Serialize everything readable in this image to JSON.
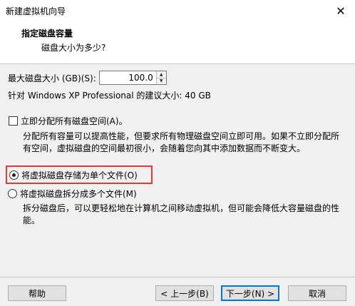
{
  "window": {
    "title": "新建虚拟机向导",
    "close_symbol": "✕"
  },
  "header": {
    "title": "指定磁盘容量",
    "subtitle": "磁盘大小为多少?"
  },
  "disk_size": {
    "label": "最大磁盘大小 (GB)(S):",
    "value": "100.0",
    "recommendation": "针对 Windows XP Professional 的建议大小: 40 GB"
  },
  "options": {
    "allocate_now": {
      "label": "立即分配所有磁盘空间(A)。",
      "checked": false,
      "description": "分配所有容量可以提高性能，但要求所有物理磁盘空间立即可用。如果不立即分配所有空间，虚拟磁盘的空间最初很小，会随着您向其中添加数据而不断变大。"
    },
    "single_file": {
      "label": "将虚拟磁盘存储为单个文件(O)",
      "selected": true
    },
    "multi_file": {
      "label": "将虚拟磁盘拆分成多个文件(M)",
      "selected": false,
      "description": "拆分磁盘后，可以更轻松地在计算机之间移动虚拟机，但可能会降低大容量磁盘的性能。"
    }
  },
  "buttons": {
    "help": "帮助",
    "back": "< 上一步(B)",
    "next": "下一步(N) >",
    "cancel": "取消"
  },
  "colors": {
    "highlight_border": "#e53935",
    "default_button_border": "#0078d7"
  }
}
